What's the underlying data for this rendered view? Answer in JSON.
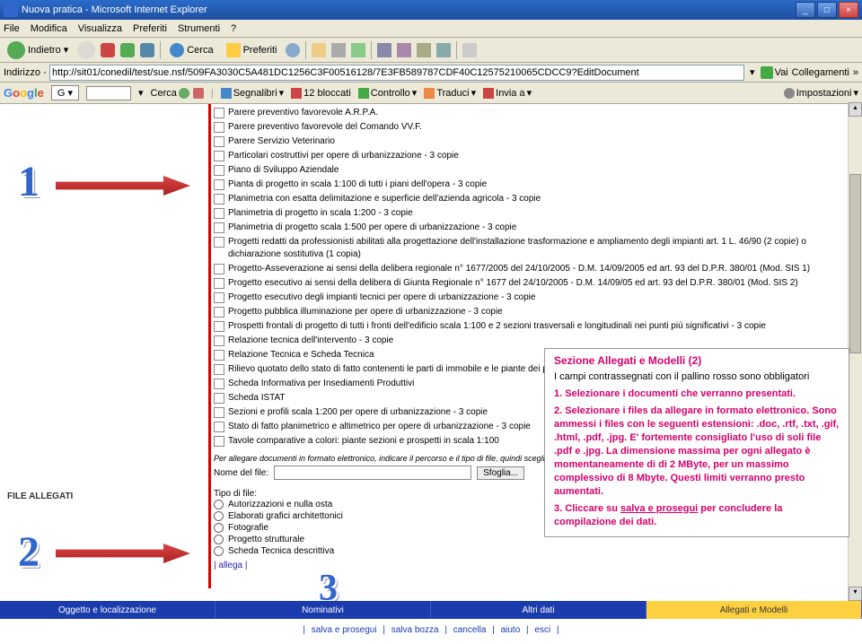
{
  "window": {
    "title": "Nuova pratica - Microsoft Internet Explorer"
  },
  "menu": [
    "File",
    "Modifica",
    "Visualizza",
    "Preferiti",
    "Strumenti",
    "?"
  ],
  "toolbar": {
    "back": "Indietro",
    "search": "Cerca",
    "favorites": "Preferiti"
  },
  "address": {
    "label": "Indirizzo",
    "url": "http://sit01/conedil/test/sue.nsf/509FA3030C5A481DC1256C3F00516128/7E3FB589787CDF40C12575210065CDCC9?EditDocument",
    "go": "Vai",
    "links": "Collegamenti"
  },
  "google": {
    "brand": "Google",
    "search": "Cerca",
    "bookmark": "Segnalibri",
    "blocked": "12 bloccati",
    "check": "Controllo",
    "translate": "Traduci",
    "send": "Invia a",
    "settings": "Impostazioni"
  },
  "checkboxes": [
    "Parere preventivo favorevole A.R.P.A.",
    "Parere preventivo favorevole del Comando VV.F.",
    "Parere Servizio Veterinario",
    "Particolari costruttivi per opere di urbanizzazione - 3 copie",
    "Piano di Sviluppo Aziendale",
    "Pianta di progetto in scala 1:100 di tutti i piani dell'opera - 3 copie",
    "Planimetria con esatta delimitazione e superficie dell'azienda agricola - 3 copie",
    "Planimetria di progetto in scala 1:200 - 3 copie",
    "Planimetria di progetto scala 1:500 per opere di urbanizzazione - 3 copie",
    "Progetti redatti da professionisti abilitati alla progettazione dell'installazione trasformazione e ampliamento degli impianti art. 1 L. 46/90 (2 copie) o dichiarazione sostitutiva (1 copia)",
    "Progetto-Asseverazione ai sensi della delibera regionale n° 1677/2005 del 24/10/2005 - D.M. 14/09/2005 ed art. 93 del D.P.R. 380/01 (Mod. SIS 1)",
    "Progetto esecutivo ai sensi della delibera di Giunta Regionale n° 1677 del 24/10/2005 - D.M. 14/09/05 ed art. 93 del D.P.R. 380/01 (Mod. SIS 2)",
    "Progetto esecutivo degli impianti tecnici per opere di urbanizzazione - 3 copie",
    "Progetto pubblica illuminazione per opere di urbanizzazione - 3 copie",
    "Prospetti frontali di progetto di tutti i fronti dell'edificio scala 1:100 e 2 sezioni trasversali e longitudinali nei punti più significativi - 3 copie",
    "Relazione tecnica dell'intervento - 3 copie",
    "Relazione Tecnica e Scheda Tecnica",
    "Rilievo quotato dello stato di fatto contenenti le parti di immobile e le piante dei piani",
    "Scheda Informativa per Insediamenti Produttivi",
    "Scheda ISTAT",
    "Sezioni e profili scala 1:200 per opere di urbanizzazione - 3 copie",
    "Stato di fatto planimetrico e altimetrico per opere di urbanizzazione - 3 copie",
    "Tavole comparative a colori: piante sezioni e prospetti in scala 1:100"
  ],
  "file_section": {
    "label": "FILE ALLEGATI",
    "hint": "Per allegare documenti in formato elettronico, indicare il percorso e il tipo di file, quindi scegliere 'allega'",
    "name_label": "Nome del file:",
    "browse": "Sfoglia...",
    "type_label": "Tipo di file:",
    "radios": [
      "Autorizzazioni e nulla osta",
      "Elaborati grafici architettonici",
      "Fotografie",
      "Progetto strutturale",
      "Scheda Tecnica descrittiva"
    ],
    "attach_link": "| allega |"
  },
  "infobox": {
    "title": "Sezione Allegati e Modelli (2)",
    "intro": "I campi contrassegnati con il pallino rosso sono obbligatori",
    "p1a": "1.",
    "p1b": "Selezionare i documenti che verranno presentati.",
    "p2a": "2.",
    "p2b": "Selezionare i files da allegare in formato elettronico. Sono ammessi i files con le seguenti estensioni: .doc, .rtf, .txt, .gif, .html, .pdf, .jpg. E' fortemente consigliato l'uso di soli file .pdf e .jpg. La dimensione massima per ogni allegato è momentaneamente di di 2 MByte, per un massimo complessivo di 8 Mbyte. Questi limiti verranno presto aumentati.",
    "p3a": "3.",
    "p3b1": "Cliccare su ",
    "p3b2": "salva e prosegui",
    "p3b3": " per concludere la compilazione dei dati."
  },
  "tabs": [
    "Oggetto e localizzazione",
    "Nominativi",
    "Altri dati",
    "Allegati e Modelli"
  ],
  "bottom_links": [
    "salva e prosegui",
    "salva bozza",
    "cancella",
    "aiuto",
    "esci"
  ],
  "nums": {
    "n1": "1",
    "n2": "2",
    "n3": "3"
  }
}
